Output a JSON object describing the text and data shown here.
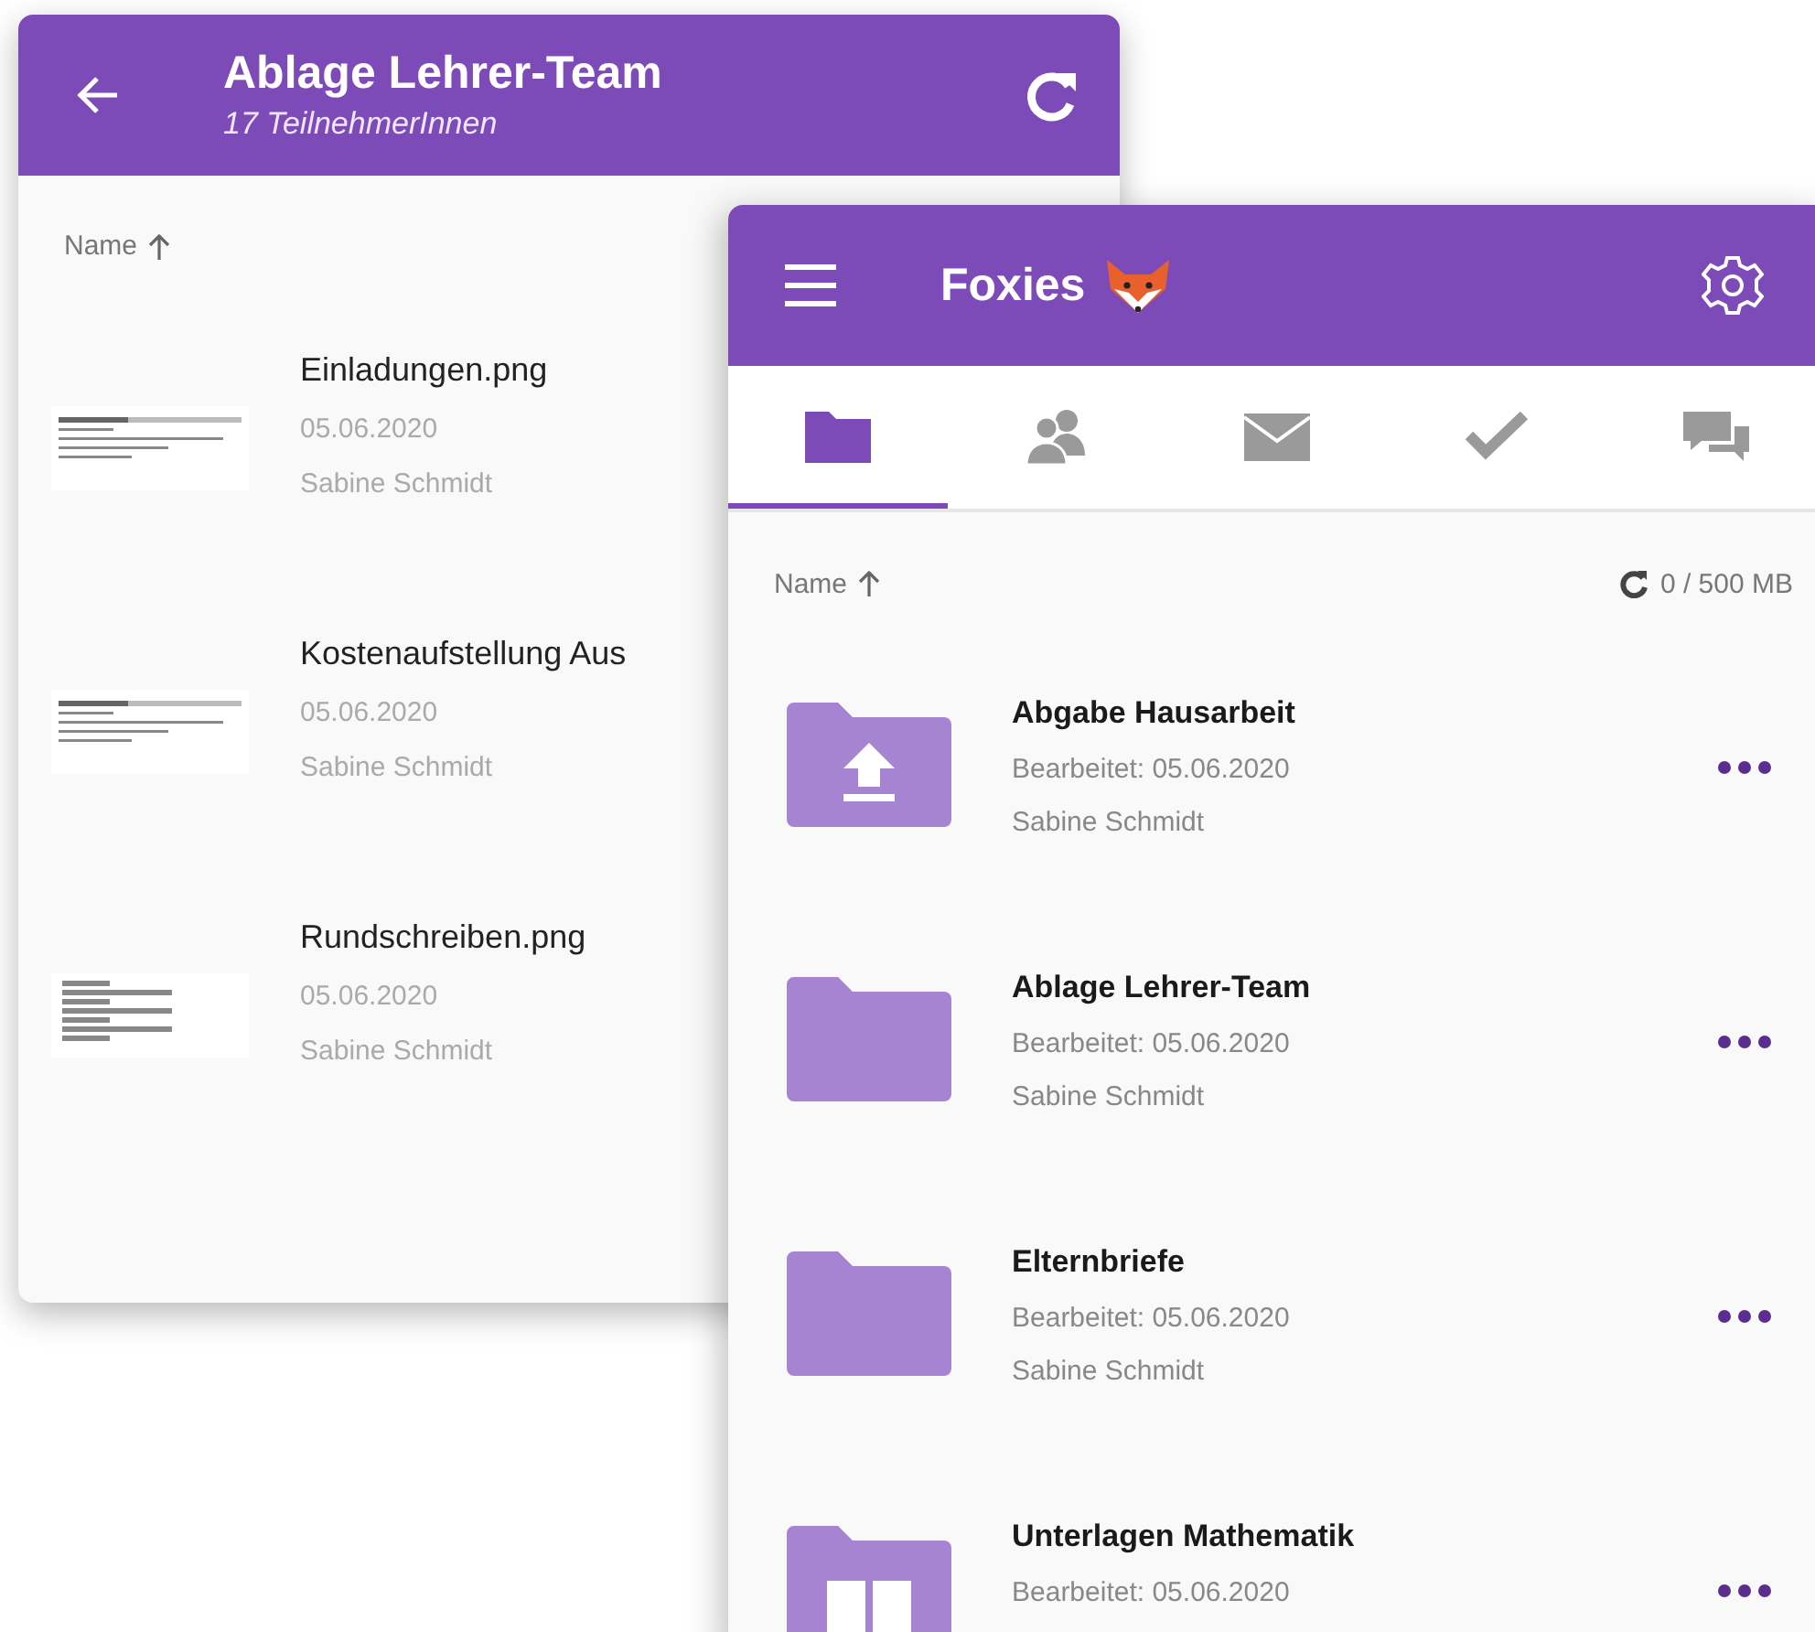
{
  "back_window": {
    "title": "Ablage Lehrer-Team",
    "subtitle": "17 TeilnehmerInnen",
    "sort_label": "Name",
    "files": [
      {
        "name": "Einladungen.png",
        "date": "05.06.2020",
        "author": "Sabine Schmidt"
      },
      {
        "name": "Kostenaufstellung Aus",
        "date": "05.06.2020",
        "author": "Sabine Schmidt"
      },
      {
        "name": "Rundschreiben.png",
        "date": "05.06.2020",
        "author": "Sabine Schmidt"
      }
    ]
  },
  "front_window": {
    "title": "Foxies",
    "tabs": [
      {
        "kind": "folder",
        "selected": true
      },
      {
        "kind": "people",
        "selected": false
      },
      {
        "kind": "mail",
        "selected": false
      },
      {
        "kind": "check",
        "selected": false
      },
      {
        "kind": "chat",
        "selected": false
      }
    ],
    "sort_label": "Name",
    "storage": "0 / 500 MB",
    "folders": [
      {
        "kind": "upload",
        "name": "Abgabe Hausarbeit",
        "edited": "Bearbeitet: 05.06.2020",
        "author": "Sabine Schmidt"
      },
      {
        "kind": "plain",
        "name": "Ablage Lehrer-Team",
        "edited": "Bearbeitet: 05.06.2020",
        "author": "Sabine Schmidt"
      },
      {
        "kind": "plain",
        "name": "Elternbriefe",
        "edited": "Bearbeitet: 05.06.2020",
        "author": "Sabine Schmidt"
      },
      {
        "kind": "book",
        "name": "Unterlagen Mathematik",
        "edited": "Bearbeitet: 05.06.2020"
      }
    ]
  }
}
